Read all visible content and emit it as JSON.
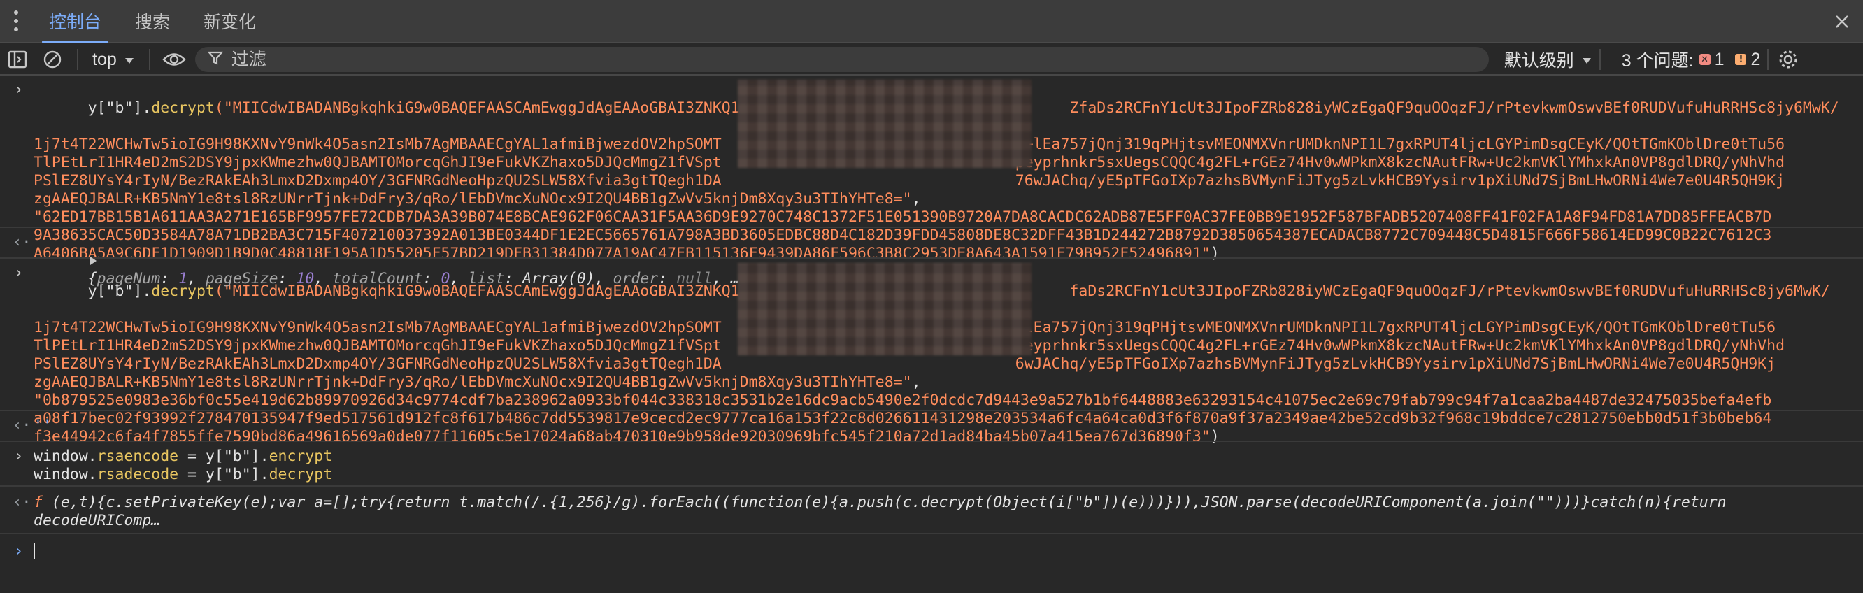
{
  "tabs": [
    {
      "label": "控制台",
      "active": true
    },
    {
      "label": "搜索",
      "active": false
    },
    {
      "label": "新变化",
      "active": false
    }
  ],
  "toolbar": {
    "context": "top",
    "filter_placeholder": "过滤",
    "level": "默认级别",
    "issues_label": "3 个问题:",
    "error_count": "1",
    "warning_count": "2"
  },
  "colors": {
    "accent": "#7cacf8",
    "string": "#ff8d5c",
    "error": "#f28b82",
    "warning": "#fcad70"
  },
  "console": {
    "entry1": {
      "l1a": "y[\"b\"].",
      "l1b": "decrypt",
      "l1c": "(\"MIICdwIBADANBgkqhkiG9w0BAQEFAASCAmEwggJdAgEAAoGBAI3ZNKQ18Tdy",
      "l1d": "ZfaDs2RCFnY1cUt3JIpoFZRb828iyWCzEgaQF9quOOqzFJ/rPtevkwmOswvBEf0RUDVufuHuRRHSc8jy6MwK/",
      "l2a": "1j7t4T22WCHwTw5ioIG9H98KXNvY9nWk4O5asn2IsMb7AgMBAAECgYAL1afmiBjwezdOV2hpSOMT",
      "l2b": "h+lEa757jQnj319qPHjtsvMEONMXVnrUMDknNPI1L7gxRPUT4ljcLGYPimDsgCEyK/QOtTGmKOblDre0tTu56",
      "l3a": "TlPEtLrI1HR4eD2mS2DSY9jpxKWmezhw0QJBAMTOMorcqGhJI9eFukVKZhaxo5DJQcMmgZ1fVSpt",
      "l3b": "peyprhnkr5sxUegsCQQC4g2FL+rGEz74Hv0wWPkmX8kzcNAutFRw+Uc2kmVKlYMhxkAn0VP8gdlDRQ/yNhVhd",
      "l4a": "PSlEZ8UYsY4rIyN/BezRAkEAh3LmxD2Dxmp4OY/3GFNRGdNeoHpzQU2SLW58Xfvia3gtTQegh1DA",
      "l4b": "76wJAChq/yE5pTFGoIXp7azhsBVMynFiJTyg5zLvkHCB9Yysirv1pXiUNd7SjBmLHwORNi4We7e0U4R5QH9Kj",
      "l5": "zgAAEQJBALR+KB5NmY1e8tsl8RzUNrrTjnk+DdFry3/qRo/lEbDVmcXuNOcx9I2QU4BB1gZwVv5knjDm8Xqy3u3TIhYHTe8=\"",
      "l5b": ",",
      "l6": "\"62ED17BB15B1A611AA3A271E165BF9957FE72CDB7DA3A39B074E8BCAE962F06CAA31F5AA36D9E9270C748C1372F51E051390B9720A7DA8CACDC62ADB87E5FF0AC37FE0BB9E1952F587BFADB5207408FF41F02FA1A8F94FD81A7DD85FFEACB7D",
      "l7": "9A38635CAC50D3584A78A71DB2BA3C715F407210037392A013BE0344DF1E2EC5665761A798A3BD3605EDBC88D4C182D39FDD45808DE8C32DFF43B1D244272B8792D3850654387ECADACB8772C709448C5D4815F666F58614ED99C0B22C7612C3",
      "l8": "A6406BA5A9C6DF1D1909D1B9D0C48818F195A1D55205F57BD219DFB31384D077A19AC47EB115136F9439DA86F596C3B8C2953DE8A643A1591F79B952F52496891\"",
      "l8b": ")"
    },
    "result1": {
      "open": "{",
      "k1": "pageNum",
      "v1": "1",
      "k2": "pageSize",
      "v2": "10",
      "k3": "totalCount",
      "v3": "0",
      "k4": "list",
      "v4": "Array(0)",
      "k5": "order",
      "v5": "null",
      "tail": ", …}"
    },
    "entry2": {
      "l1a": "y[\"b\"].",
      "l1b": "decrypt",
      "l1c": "(\"MIICdwIBADANBgkqhkiG9w0BAQEFAASCAmEwggJdAgEAAoGBAI3ZNKQ18Tdy",
      "l1d": "faDs2RCFnY1cUt3JIpoFZRb828iyWCzEgaQF9quOOqzFJ/rPtevkwmOswvBEf0RUDVufuHuRRHSc8jy6MwK/",
      "l2a": "1j7t4T22WCHwTw5ioIG9H98KXNvY9nWk4O5asn2IsMb7AgMBAAECgYAL1afmiBjwezdOV2hpSOMT",
      "l2b": "+lEa757jQnj319qPHjtsvMEONMXVnrUMDknNPI1L7gxRPUT4ljcLGYPimDsgCEyK/QOtTGmKOblDre0tTu56",
      "l3a": "TlPEtLrI1HR4eD2mS2DSY9jpxKWmezhw0QJBAMTOMorcqGhJI9eFukVKZhaxo5DJQcMmgZ1fVSpt",
      "l3b": "peyprhnkr5sxUegsCQQC4g2FL+rGEz74Hv0wWPkmX8kzcNAutFRw+Uc2kmVKlYMhxkAn0VP8gdlDRQ/yNhVhd",
      "l4a": "PSlEZ8UYsY4rIyN/BezRAkEAh3LmxD2Dxmp4OY/3GFNRGdNeoHpzQU2SLW58Xfvia3gtTQegh1DA",
      "l4b": "6wJAChq/yE5pTFGoIXp7azhsBVMynFiJTyg5zLvkHCB9Yysirv1pXiUNd7SjBmLHwORNi4We7e0U4R5QH9Kj",
      "l5": "zgAAEQJBALR+KB5NmY1e8tsl8RzUNrrTjnk+DdFry3/qRo/lEbDVmcXuNOcx9I2QU4BB1gZwVv5knjDm8Xqy3u3TIhYHTe8=\"",
      "l5b": ",",
      "l6": "\"0b879525e0983e36bf0c55e419d62b89970926d34c9774cdf7ba238962a0933bf044c338318c3531b2e16dc9acb5490e2f0dcdc7d9443e9a527b1bf6448883e63293154c41075ec2e69c79fab799c94f7a1caa2ba4487de32475035befa4efb",
      "l7": "a08f17bec02f93992f278470135947f9ed517561d912fc8f617b486c7dd5539817e9cecd2ec9777ca16a153f22c8d026611431298e203534a6fc4a64ca0d3f6f870a9f37a2349ae42be52cd9b32f968c19bddce7c2812750ebb0d51f3b0beb64",
      "l8": "f3e44942c6fa4f7855ffe7590bd86a49616569a0de077f11605c5e17024a68ab470310e9b958de92030969bfc545f210a72d1ad84ba45b07a415ea767d36890f3\"",
      "l8b": ")"
    },
    "result2": "''",
    "entry3": {
      "l1a": "window.",
      "l1b": "rsaencode",
      "l1c": " = y[\"b\"].",
      "l1d": "encrypt",
      "l2a": "window.",
      "l2b": "rsadecode",
      "l2c": " = y[\"b\"].",
      "l2d": "decrypt"
    },
    "result3": {
      "f": "f",
      "l1": " (e,t){c.setPrivateKey(e);var a=[];try{return t.match(/.{1,256}/g).forEach((function(e){a.push(c.decrypt(Object(i[\"b\"])(e)))})),JSON.parse(decodeURIComponent(a.join(\"\")))}catch(n){return",
      "l2": "decodeURIComp…"
    }
  }
}
